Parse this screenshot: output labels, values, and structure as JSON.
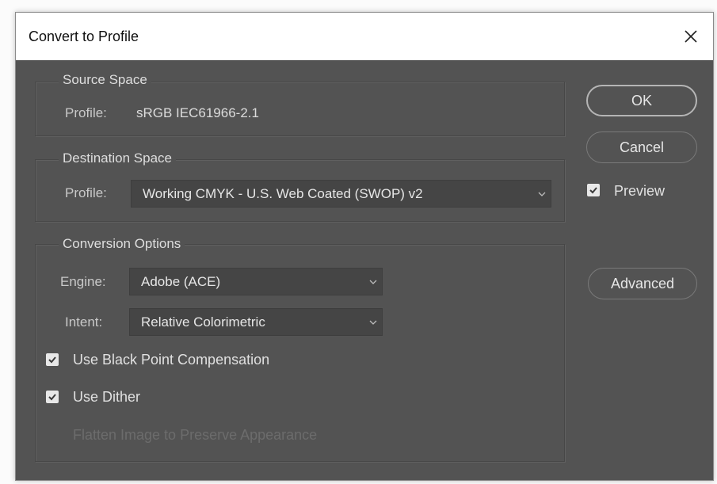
{
  "window": {
    "title": "Convert to Profile"
  },
  "source_space": {
    "heading": "Source Space",
    "profile_label": "Profile:",
    "profile_value": "sRGB IEC61966-2.1"
  },
  "destination_space": {
    "heading": "Destination Space",
    "profile_label": "Profile:",
    "profile_selected": "Working CMYK - U.S. Web Coated (SWOP) v2"
  },
  "conversion_options": {
    "heading": "Conversion Options",
    "engine_label": "Engine:",
    "engine_selected": "Adobe (ACE)",
    "intent_label": "Intent:",
    "intent_selected": "Relative Colorimetric",
    "black_point": {
      "label": "Use Black Point Compensation",
      "checked": true
    },
    "dither": {
      "label": "Use Dither",
      "checked": true
    },
    "flatten": {
      "label": "Flatten Image to Preserve Appearance",
      "checked": false,
      "disabled": true
    }
  },
  "buttons": {
    "ok": "OK",
    "cancel": "Cancel",
    "advanced": "Advanced"
  },
  "preview": {
    "label": "Preview",
    "checked": true
  },
  "icons": {
    "close": "close-icon",
    "chevron": "chevron-down-icon",
    "check": "checkmark-icon"
  },
  "colors": {
    "panel": "#535353",
    "field": "#454545",
    "titlebar": "#ffffff"
  }
}
